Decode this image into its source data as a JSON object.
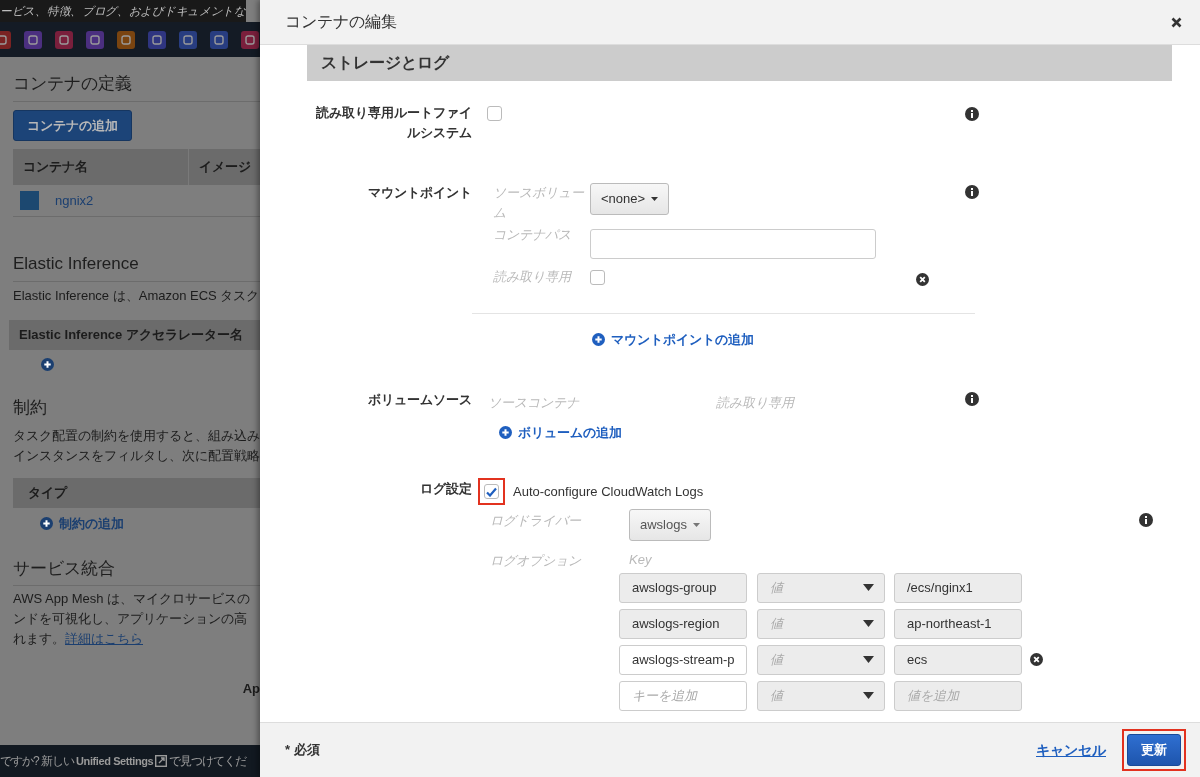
{
  "background_page": {
    "banner": "ービス、特徴、ブログ、およびドキュメントな",
    "service_icons": [
      {
        "color": "#7a2222"
      },
      {
        "color": "#4b2f80"
      },
      {
        "color": "#7a1f3c"
      },
      {
        "color": "#4b2f80"
      },
      {
        "color": "#7a4410"
      },
      {
        "color": "#2f3580"
      },
      {
        "color": "#283d80"
      },
      {
        "color": "#283d80"
      },
      {
        "color": "#7a1f3c"
      }
    ],
    "container_section": {
      "title": "コンテナの定義",
      "add_button": "コンテナの追加",
      "columns": [
        "コンテナ名",
        "イメージ"
      ],
      "rows": [
        {
          "name": "ngnix2"
        }
      ]
    },
    "inference_section": {
      "title": "Elastic Inference",
      "description": "Elastic Inference は、Amazon ECS タスク",
      "column": "Elastic Inference アクセラレーター名"
    },
    "constraint_section": {
      "title": "制約",
      "description_lines": [
        "タスク配置の制約を使用すると、組み込み",
        "インスタンスをフィルタし、次に配置戦略"
      ],
      "column": "タイプ",
      "add_link": "制約の追加"
    },
    "service_section": {
      "title": "サービス統合",
      "description_lines": [
        "AWS App Mesh は、マイクロサービスの",
        "ンドを可視化し、アプリケーションの高",
        "れます。"
      ],
      "link": "詳細はこちら",
      "fragment": "Ap"
    },
    "settings_bar": {
      "before": "ですか? 新しい",
      "link": "Unified Settings",
      "after": "で見つけてくだ"
    }
  },
  "modal": {
    "title": "コンテナの編集",
    "section": {
      "title": "ストレージとログ"
    },
    "readonly_root": {
      "label": "読み取り専用ルートファイルシステム",
      "checked": false
    },
    "mount_points": {
      "label": "マウントポイント",
      "fields": [
        {
          "kind": "select",
          "label": "ソースボリューム",
          "value": "<none>"
        },
        {
          "kind": "text",
          "label": "コンテナパス"
        },
        {
          "kind": "checkbox",
          "label": "読み取り専用",
          "checked": false,
          "removable": true
        }
      ],
      "add_link": "マウントポイントの追加"
    },
    "volume_sources": {
      "label": "ボリュームソース",
      "columns": [
        "ソースコンテナ",
        "読み取り専用"
      ],
      "add_link": "ボリュームの追加"
    },
    "log_config": {
      "label": "ログ設定",
      "auto_configure": {
        "label": "Auto-configure CloudWatch Logs",
        "checked": true,
        "highlighted": true
      },
      "driver": {
        "label": "ログドライバー",
        "value": "awslogs"
      },
      "options": {
        "label": "ログオプション",
        "key_header": "Key",
        "rows": [
          {
            "key": "awslogs-group",
            "type": "値",
            "value": "/ecs/nginx1",
            "disabled": true,
            "removable": false
          },
          {
            "key": "awslogs-region",
            "type": "値",
            "value": "ap-northeast-1",
            "disabled": true,
            "removable": false
          },
          {
            "key": "awslogs-stream-p",
            "type": "値",
            "value": "ecs",
            "disabled": false,
            "removable": true
          },
          {
            "key_placeholder": "キーを追加",
            "type": "値",
            "value_placeholder": "値を追加",
            "disabled": false,
            "removable": false
          }
        ]
      }
    },
    "footer": {
      "required_note": "* 必須",
      "cancel": "キャンセル",
      "submit": {
        "label": "更新",
        "highlighted": true
      }
    }
  }
}
